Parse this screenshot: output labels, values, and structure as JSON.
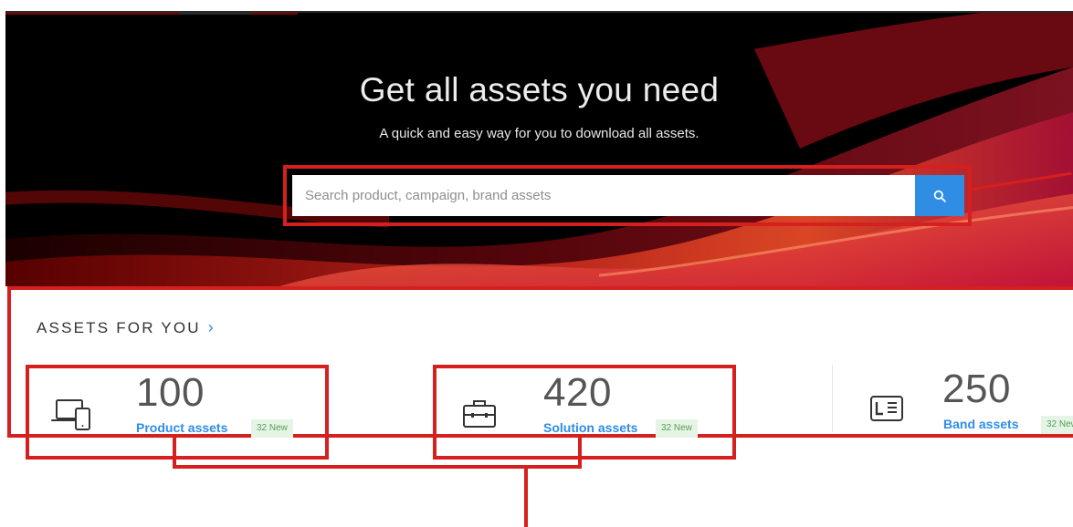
{
  "hero": {
    "title": "Get all assets you need",
    "subtitle": "A quick and easy way for you to download all assets."
  },
  "search": {
    "placeholder": "Search product, campaign, brand assets",
    "value": "",
    "button_icon": "search-icon"
  },
  "assets": {
    "heading": "ASSETS FOR YOU",
    "heading_icon": "chevron-right-icon",
    "cards": [
      {
        "icon": "laptop-phone-icon",
        "count": "100",
        "label": "Product assets",
        "badge": "32 New"
      },
      {
        "icon": "briefcase-icon",
        "count": "420",
        "label": "Solution assets",
        "badge": "32 New"
      },
      {
        "icon": "id-card-icon",
        "count": "250",
        "label": "Band assets",
        "badge": "32 New"
      }
    ]
  },
  "colors": {
    "accent_blue": "#2f8de4",
    "callout_red": "#d61f1f",
    "badge_bg": "#e5f4e5",
    "badge_text": "#55a055"
  }
}
